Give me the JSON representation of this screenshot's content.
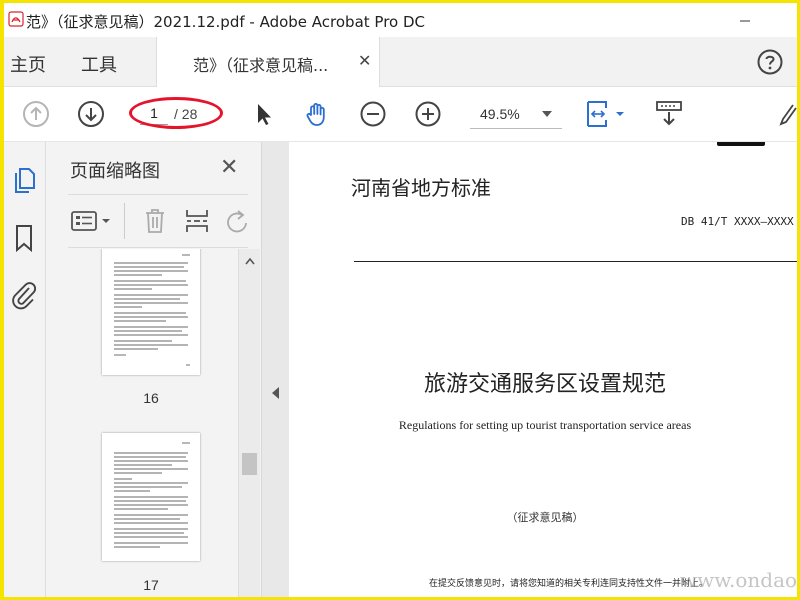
{
  "window": {
    "title": "范》（征求意见稿）2021.12.pdf - Adobe Acrobat Pro DC"
  },
  "tabs": {
    "home": "主页",
    "tools": "工具",
    "document": "范》（征求意见稿..."
  },
  "toolbar": {
    "current_page": "1",
    "total_pages": "/ 28",
    "zoom": "49.5%"
  },
  "panel": {
    "title": "页面缩略图",
    "thumbnails": [
      {
        "page": "16"
      },
      {
        "page": "17"
      }
    ]
  },
  "document": {
    "standard_name": "河南省地方标准",
    "code": "DB 41/T XXXX—XXXX",
    "title_cn": "旅游交通服务区设置规范",
    "title_en": "Regulations for setting up tourist transportation service areas",
    "draft_label": "（征求意见稿）",
    "footer_note": "在提交反馈意见时，请将您知道的相关专利连同支持性文件一并附上。"
  },
  "watermark": "www.ondao.com",
  "colors": {
    "frame": "#f5e400",
    "accent_blue": "#2b6fcf",
    "annotation_red": "#e5132b",
    "acrobat_red": "#d8262e"
  },
  "icons": {
    "prev_page": "arrow-up-circle-icon",
    "next_page": "arrow-down-circle-icon",
    "select": "cursor-arrow-icon",
    "hand": "hand-icon",
    "zoom_out": "minus-circle-icon",
    "zoom_in": "plus-circle-icon",
    "fit": "fit-page-icon",
    "scroll_mode": "scroll-mode-icon",
    "help": "help-icon"
  }
}
